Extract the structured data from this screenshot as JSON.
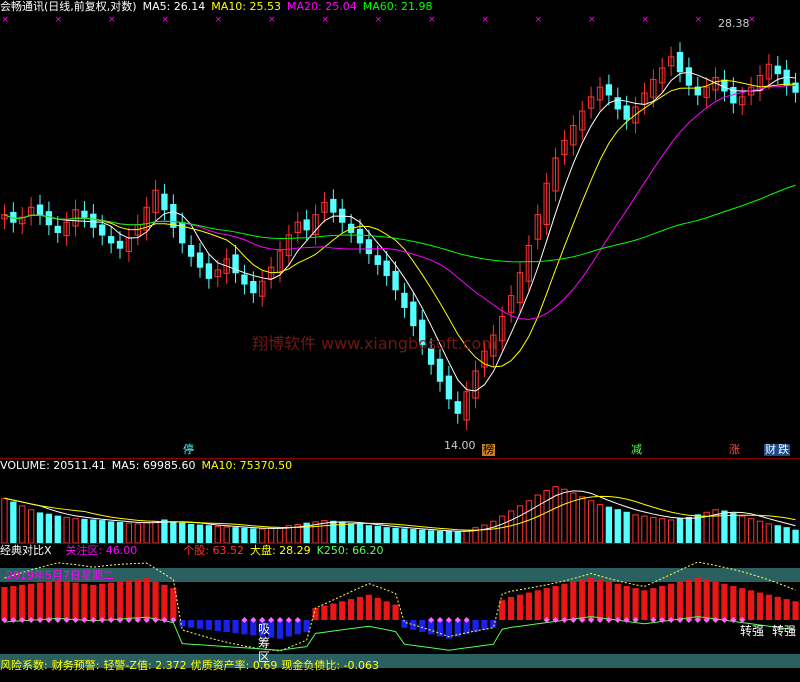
{
  "main_header": {
    "title": "会畅通讯(日线,前复权,对数)",
    "ma5_label": "MA5: 26.14",
    "ma10_label": "MA10: 25.53",
    "ma20_label": "MA20: 25.04",
    "ma60_label": "MA60: 21.98"
  },
  "main_panel": {
    "high_marker": "28.38",
    "low_marker": "14.00",
    "watermark": "翔博软件 www.xiangbosoft.com",
    "tags": [
      "停",
      "榜",
      "减",
      "涨",
      "财",
      "跌"
    ]
  },
  "volume_header": {
    "volume_label": "VOLUME: 20511.41",
    "ma5_label": "MA5: 69985.60",
    "ma10_label": "MA10: 75370.50"
  },
  "indicator_header": {
    "name": "经典对比X",
    "focus_label": "关注区: 46.00",
    "stock_label": "个股: 63.52",
    "market_label": "大盘: 28.29",
    "k250_label": "K250: 66.20"
  },
  "indicator_panel": {
    "date_label": "2019年5月7日星期二",
    "absorb_label": [
      "吸",
      "筹",
      "区"
    ],
    "strong_labels": [
      "转强",
      "转强"
    ]
  },
  "footer": {
    "risk_label": "风险系数:",
    "warning_label": "财务预警:",
    "zscore_label": "轻警-Z值: 2.372",
    "quality_label": "优质资产率: 0.69",
    "cashdebt_label": "现金负债比: -0.063"
  },
  "colors": {
    "up": "#ff3232",
    "down": "#54ffff",
    "ma5": "#ffffff",
    "ma10": "#ffff00",
    "ma20": "#ff00ff",
    "ma60": "#00ff00",
    "band": "#2a6060"
  },
  "chart_data": [
    {
      "type": "candlestick",
      "title": "会畅通讯(日线,前复权,对数)",
      "y_log": true,
      "ylim": [
        14.0,
        28.38
      ],
      "annotations": [
        "28.38",
        "14.00"
      ],
      "series": [
        {
          "name": "MA5",
          "last": 26.14
        },
        {
          "name": "MA10",
          "last": 25.53
        },
        {
          "name": "MA20",
          "last": 25.04
        },
        {
          "name": "MA60",
          "last": 21.98
        }
      ],
      "close_series": [
        20.6,
        20.3,
        20.5,
        20.9,
        20.6,
        20.2,
        19.9,
        20.3,
        20.8,
        20.5,
        20.1,
        19.8,
        19.5,
        19.3,
        19.7,
        20.2,
        20.9,
        21.6,
        20.8,
        20.1,
        19.5,
        19.0,
        18.6,
        18.2,
        18.5,
        18.9,
        18.4,
        18.0,
        17.7,
        18.1,
        18.6,
        19.2,
        19.8,
        20.3,
        20.0,
        20.6,
        21.1,
        20.7,
        20.3,
        19.9,
        19.5,
        19.1,
        18.7,
        18.3,
        17.8,
        17.2,
        16.6,
        16.0,
        15.4,
        14.9,
        14.4,
        14.0,
        14.6,
        15.2,
        15.8,
        16.3,
        16.9,
        17.6,
        18.4,
        19.4,
        20.6,
        21.9,
        23.0,
        23.8,
        24.5,
        25.2,
        25.9,
        26.4,
        26.0,
        25.3,
        24.8,
        25.4,
        26.1,
        26.8,
        27.4,
        28.0,
        27.2,
        26.5,
        26.0,
        26.4,
        26.9,
        26.2,
        25.6,
        25.9,
        26.4,
        27.0,
        27.6,
        27.1,
        26.5,
        26.14
      ]
    },
    {
      "type": "bar",
      "title": "VOLUME",
      "series": [
        {
          "name": "VOLUME",
          "last": 20511.41
        },
        {
          "name": "MA5",
          "last": 69985.6
        },
        {
          "name": "MA10",
          "last": 75370.5
        }
      ],
      "values": [
        70,
        64,
        58,
        52,
        47,
        45,
        42,
        40,
        38,
        37,
        36,
        35,
        33,
        32,
        31,
        30,
        32,
        34,
        36,
        33,
        31,
        29,
        28,
        27,
        26,
        25,
        24,
        23,
        22,
        22,
        23,
        24,
        27,
        29,
        31,
        33,
        35,
        34,
        32,
        30,
        29,
        27,
        26,
        24,
        23,
        22,
        21,
        20,
        19,
        18,
        18,
        17,
        20,
        24,
        28,
        34,
        42,
        50,
        58,
        66,
        75,
        82,
        88,
        84,
        78,
        72,
        66,
        60,
        56,
        52,
        48,
        44,
        42,
        40,
        38,
        36,
        38,
        40,
        44,
        48,
        52,
        50,
        46,
        42,
        38,
        34,
        30,
        27,
        24,
        20
      ]
    },
    {
      "type": "bar",
      "title": "经典对比X",
      "series": [
        {
          "name": "关注区",
          "last": 46.0
        },
        {
          "name": "个股",
          "last": 63.52
        },
        {
          "name": "大盘",
          "last": 28.29
        },
        {
          "name": "K250",
          "last": 66.2
        }
      ],
      "values": [
        60,
        62,
        64,
        66,
        68,
        70,
        72,
        70,
        68,
        66,
        64,
        66,
        68,
        70,
        72,
        74,
        76,
        70,
        64,
        58,
        -12,
        -14,
        -16,
        -18,
        -20,
        -22,
        -24,
        -26,
        -28,
        -30,
        -32,
        -34,
        -30,
        -26,
        -22,
        22,
        26,
        30,
        34,
        38,
        42,
        46,
        40,
        34,
        28,
        -14,
        -18,
        -22,
        -26,
        -30,
        -34,
        -30,
        -26,
        -22,
        -18,
        -14,
        36,
        42,
        46,
        50,
        54,
        58,
        62,
        66,
        70,
        74,
        78,
        74,
        70,
        66,
        62,
        58,
        54,
        58,
        62,
        66,
        70,
        74,
        78,
        74,
        70,
        66,
        62,
        58,
        54,
        50,
        46,
        42,
        38,
        34
      ]
    }
  ]
}
